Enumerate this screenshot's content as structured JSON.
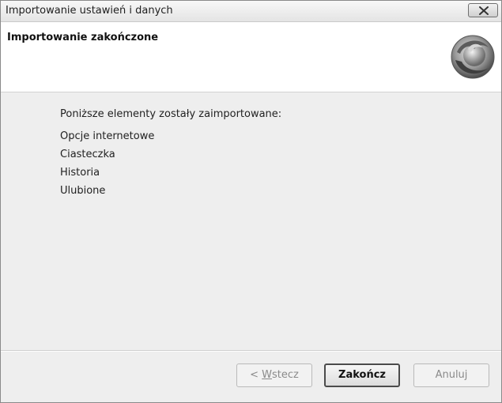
{
  "window": {
    "title": "Importowanie ustawień i danych"
  },
  "header": {
    "title": "Importowanie zakończone",
    "logo_icon": "firefox-logo-icon"
  },
  "content": {
    "intro": "Poniższe elementy zostały zaimportowane:",
    "items": [
      "Opcje internetowe",
      "Ciasteczka",
      "Historia",
      "Ulubione"
    ]
  },
  "buttons": {
    "back_prefix": "< ",
    "back_mnemonic": "W",
    "back_rest": "stecz",
    "finish": "Zakończ",
    "cancel": "Anuluj"
  },
  "titlebar_icons": {
    "close": "close-icon"
  }
}
